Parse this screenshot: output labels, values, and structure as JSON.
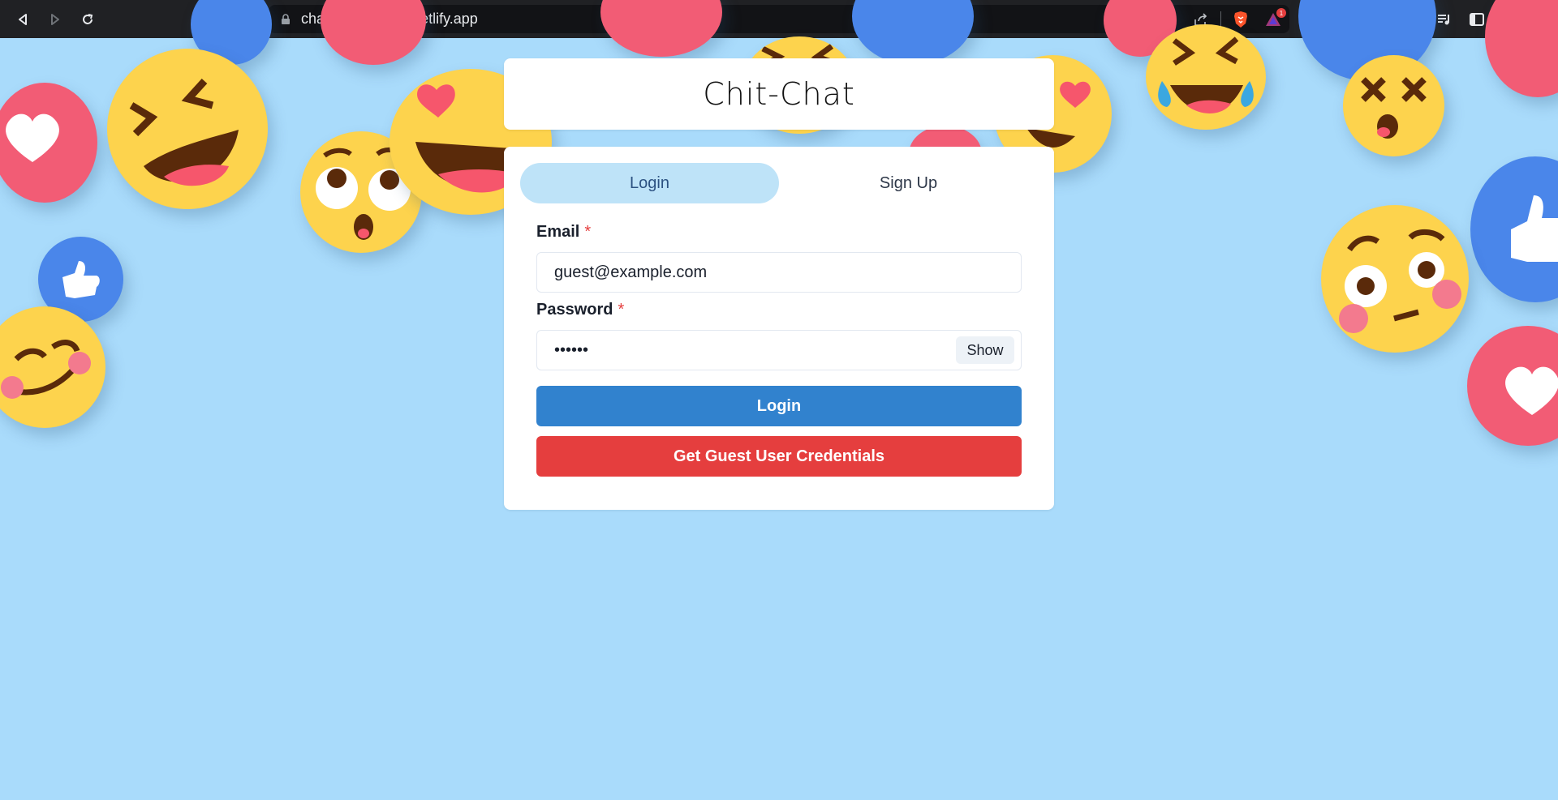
{
  "browser": {
    "url": "chatapp-chitchat.netlify.app",
    "extension_badge_count": "1"
  },
  "app": {
    "title": "Chit-Chat"
  },
  "tabs": [
    {
      "label": "Login",
      "active": true
    },
    {
      "label": "Sign Up",
      "active": false
    }
  ],
  "form": {
    "email_label": "Email",
    "email_value": "guest@example.com",
    "password_label": "Password",
    "password_value": "••••••",
    "required_mark": "*",
    "show_label": "Show",
    "login_button": "Login",
    "guest_button": "Get Guest User Credentials"
  },
  "colors": {
    "background": "#a9dbfb",
    "tab_active": "#bee3f8",
    "login_button": "#3182ce",
    "guest_button": "#e53e3e",
    "required": "#e53e3e"
  }
}
